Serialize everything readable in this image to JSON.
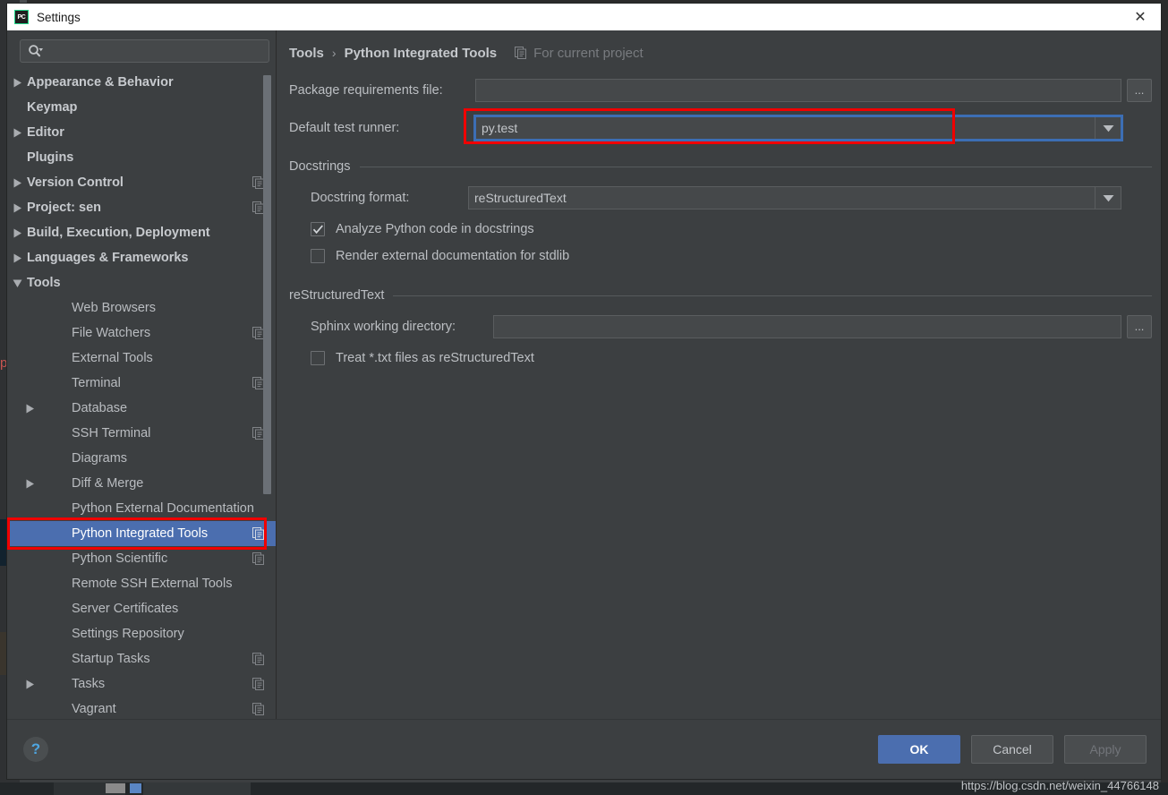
{
  "window": {
    "title": "Settings",
    "app_icon": "pycharm-icon",
    "close_label": "✕"
  },
  "sidebar": {
    "search": {
      "placeholder": "",
      "value": "",
      "icon": "search-icon"
    },
    "items": [
      {
        "label": "Appearance & Behavior",
        "level": 0,
        "twisty": "collapsed",
        "copy": false,
        "selected": false
      },
      {
        "label": "Keymap",
        "level": 0,
        "twisty": "none",
        "copy": false,
        "selected": false
      },
      {
        "label": "Editor",
        "level": 0,
        "twisty": "collapsed",
        "copy": false,
        "selected": false
      },
      {
        "label": "Plugins",
        "level": 0,
        "twisty": "none",
        "copy": false,
        "selected": false
      },
      {
        "label": "Version Control",
        "level": 0,
        "twisty": "collapsed",
        "copy": true,
        "selected": false
      },
      {
        "label": "Project: sen",
        "level": 0,
        "twisty": "collapsed",
        "copy": true,
        "selected": false
      },
      {
        "label": "Build, Execution, Deployment",
        "level": 0,
        "twisty": "collapsed",
        "copy": false,
        "selected": false
      },
      {
        "label": "Languages & Frameworks",
        "level": 0,
        "twisty": "collapsed",
        "copy": false,
        "selected": false
      },
      {
        "label": "Tools",
        "level": 0,
        "twisty": "expanded",
        "copy": false,
        "selected": false
      },
      {
        "label": "Web Browsers",
        "level": 1,
        "twisty": "none",
        "copy": false,
        "selected": false
      },
      {
        "label": "File Watchers",
        "level": 1,
        "twisty": "none",
        "copy": true,
        "selected": false
      },
      {
        "label": "External Tools",
        "level": 1,
        "twisty": "none",
        "copy": false,
        "selected": false
      },
      {
        "label": "Terminal",
        "level": 1,
        "twisty": "none",
        "copy": true,
        "selected": false
      },
      {
        "label": "Database",
        "level": 1,
        "twisty": "collapsed",
        "copy": false,
        "selected": false
      },
      {
        "label": "SSH Terminal",
        "level": 1,
        "twisty": "none",
        "copy": true,
        "selected": false
      },
      {
        "label": "Diagrams",
        "level": 1,
        "twisty": "none",
        "copy": false,
        "selected": false
      },
      {
        "label": "Diff & Merge",
        "level": 1,
        "twisty": "collapsed",
        "copy": false,
        "selected": false
      },
      {
        "label": "Python External Documentation",
        "level": 1,
        "twisty": "none",
        "copy": false,
        "selected": false
      },
      {
        "label": "Python Integrated Tools",
        "level": 1,
        "twisty": "none",
        "copy": true,
        "selected": true
      },
      {
        "label": "Python Scientific",
        "level": 1,
        "twisty": "none",
        "copy": true,
        "selected": false
      },
      {
        "label": "Remote SSH External Tools",
        "level": 1,
        "twisty": "none",
        "copy": false,
        "selected": false
      },
      {
        "label": "Server Certificates",
        "level": 1,
        "twisty": "none",
        "copy": false,
        "selected": false
      },
      {
        "label": "Settings Repository",
        "level": 1,
        "twisty": "none",
        "copy": false,
        "selected": false
      },
      {
        "label": "Startup Tasks",
        "level": 1,
        "twisty": "none",
        "copy": true,
        "selected": false
      },
      {
        "label": "Tasks",
        "level": 1,
        "twisty": "collapsed",
        "copy": true,
        "selected": false
      },
      {
        "label": "Vagrant",
        "level": 1,
        "twisty": "none",
        "copy": true,
        "selected": false
      }
    ]
  },
  "content": {
    "breadcrumb": {
      "root": "Tools",
      "separator": "›",
      "current": "Python Integrated Tools",
      "scope_icon": "copy-scope-icon",
      "scope_label": "For current project"
    },
    "package_requirements": {
      "label": "Package requirements file:",
      "value": "",
      "browse_label": "..."
    },
    "default_test_runner": {
      "label": "Default test runner:",
      "value": "py.test",
      "focused": true
    },
    "docstrings": {
      "group_title": "Docstrings",
      "format": {
        "label": "Docstring format:",
        "value": "reStructuredText"
      },
      "analyze": {
        "label": "Analyze Python code in docstrings",
        "checked": true
      },
      "render_external": {
        "label": "Render external documentation for stdlib",
        "checked": false
      }
    },
    "restructuredtext": {
      "group_title": "reStructuredText",
      "sphinx": {
        "label": "Sphinx working directory:",
        "value": "",
        "browse_label": "..."
      },
      "treat_txt": {
        "label": "Treat *.txt files as reStructuredText",
        "checked": false
      }
    }
  },
  "footer": {
    "help_label": "?",
    "ok_label": "OK",
    "cancel_label": "Cancel",
    "apply_label": "Apply"
  },
  "overlay": {
    "watermark": "https://blog.csdn.net/weixin_44766148",
    "highlight_color": "#f00000",
    "stray_char": "p"
  },
  "colors": {
    "dialog_bg": "#3c3f41",
    "field_bg": "#45484a",
    "selection": "#4b6eaf",
    "accent": "#4b6eaf",
    "focus_ring": "#3c6eb4",
    "text": "#bcbfc3"
  }
}
